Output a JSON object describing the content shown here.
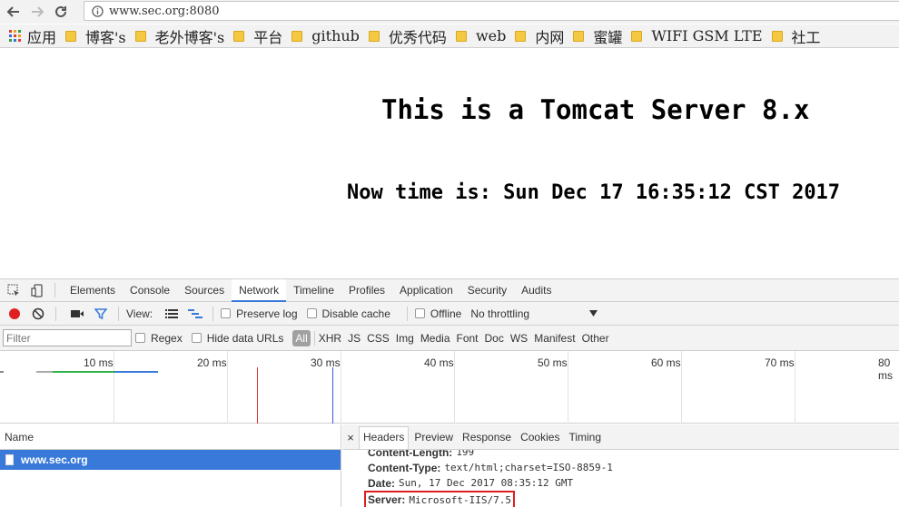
{
  "browser": {
    "url": "www.sec.org:8080",
    "bookmarks": [
      {
        "label": "应用",
        "kind": "apps"
      },
      {
        "label": "博客's",
        "kind": "folder"
      },
      {
        "label": "老外博客's",
        "kind": "folder"
      },
      {
        "label": "平台",
        "kind": "folder"
      },
      {
        "label": "github",
        "kind": "folder"
      },
      {
        "label": "优秀代码",
        "kind": "folder"
      },
      {
        "label": "web",
        "kind": "folder"
      },
      {
        "label": "内网",
        "kind": "folder"
      },
      {
        "label": "蜜罐",
        "kind": "folder"
      },
      {
        "label": "WIFI GSM LTE",
        "kind": "folder"
      },
      {
        "label": "社工",
        "kind": "folder"
      }
    ]
  },
  "page": {
    "headline": "This is a Tomcat Server 8.x",
    "now_time": "Now time is: Sun Dec 17 16:35:12 CST 2017"
  },
  "devtools": {
    "tabs": [
      "Elements",
      "Console",
      "Sources",
      "Network",
      "Timeline",
      "Profiles",
      "Application",
      "Security",
      "Audits"
    ],
    "active_tab": "Network",
    "toolbar": {
      "view_label": "View:",
      "preserve_log": "Preserve log",
      "disable_cache": "Disable cache",
      "offline": "Offline",
      "throttling": "No throttling"
    },
    "filter": {
      "placeholder": "Filter",
      "regex": "Regex",
      "hide_data_urls": "Hide data URLs",
      "types": [
        "All",
        "XHR",
        "JS",
        "CSS",
        "Img",
        "Media",
        "Font",
        "Doc",
        "WS",
        "Manifest",
        "Other"
      ],
      "active_type": "All"
    },
    "timeline": {
      "ticks": [
        "10 ms",
        "20 ms",
        "30 ms",
        "40 ms",
        "50 ms",
        "60 ms",
        "70 ms",
        "80 ms"
      ]
    },
    "requests": {
      "name_header": "Name",
      "rows": [
        "www.sec.org"
      ]
    },
    "detail": {
      "close_label": "×",
      "tabs": [
        "Headers",
        "Preview",
        "Response",
        "Cookies",
        "Timing"
      ],
      "active_tab": "Headers",
      "headers": [
        {
          "key": "Content-Length:",
          "value": "199"
        },
        {
          "key": "Content-Type:",
          "value": "text/html;charset=ISO-8859-1"
        },
        {
          "key": "Date:",
          "value": "Sun, 17 Dec 2017 08:35:12 GMT"
        },
        {
          "key": "Server:",
          "value": "Microsoft-IIS/7.5"
        }
      ]
    }
  },
  "colors": {
    "accent": "#3879d9",
    "record": "#e02020",
    "highlight_box": "#e02020",
    "folder": "#f5c842"
  }
}
